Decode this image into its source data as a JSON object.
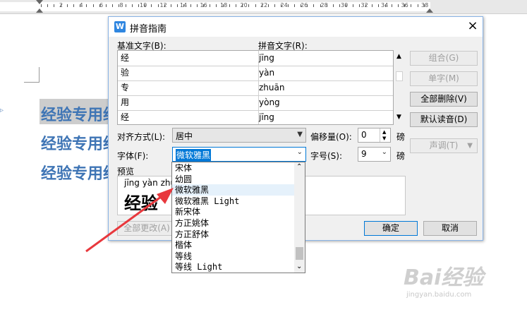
{
  "ruler": {
    "numbers": [
      "2",
      "4",
      "6",
      "8",
      "10",
      "12",
      "14",
      "16",
      "18",
      "20",
      "22",
      "24",
      "26",
      "28",
      "30",
      "32",
      "34",
      "36",
      "38"
    ]
  },
  "document": {
    "lines": [
      "经验专用经",
      "经验专用经",
      "经验专用经"
    ]
  },
  "dialog": {
    "title": "拼音指南",
    "close": "×",
    "col_base": "基准文字(B):",
    "col_pinyin": "拼音文字(R):",
    "rows": [
      {
        "base": "经",
        "pinyin": "jīng"
      },
      {
        "base": "验",
        "pinyin": "yàn"
      },
      {
        "base": "专",
        "pinyin": "zhuān"
      },
      {
        "base": "用",
        "pinyin": "yòng"
      },
      {
        "base": "经",
        "pinyin": "jīng"
      }
    ],
    "buttons": {
      "combine": "组合(G)",
      "single": "单字(M)",
      "delete_all": "全部删除(V)",
      "default_reading": "默认读音(D)",
      "tone": "声调(T)",
      "apply_all": "全部更改(A)",
      "ok": "确定",
      "cancel": "取消"
    },
    "align_label": "对齐方式(L):",
    "align_value": "居中",
    "offset_label": "偏移量(O):",
    "offset_value": "0",
    "offset_unit": "磅",
    "font_label": "字体(F):",
    "font_value": "微软雅黑",
    "size_label": "字号(S):",
    "size_value": "9",
    "size_unit": "磅",
    "preview_label": "预览",
    "preview_pinyin": "jīng yàn zhu",
    "preview_chars": "经验"
  },
  "font_dropdown": {
    "options": [
      "宋体",
      "幼圆",
      "微软雅黑",
      "微软雅黑 Light",
      "新宋体",
      "方正姚体",
      "方正舒体",
      "楷体",
      "等线",
      "等线 Light"
    ],
    "selected_index": 2
  },
  "watermark": {
    "brand": "Bai经验",
    "url": "jingyan.baidu.com"
  },
  "colors": {
    "doc_text": "#3f75b5",
    "selection": "#0078d7",
    "arrow": "#e8383d"
  }
}
